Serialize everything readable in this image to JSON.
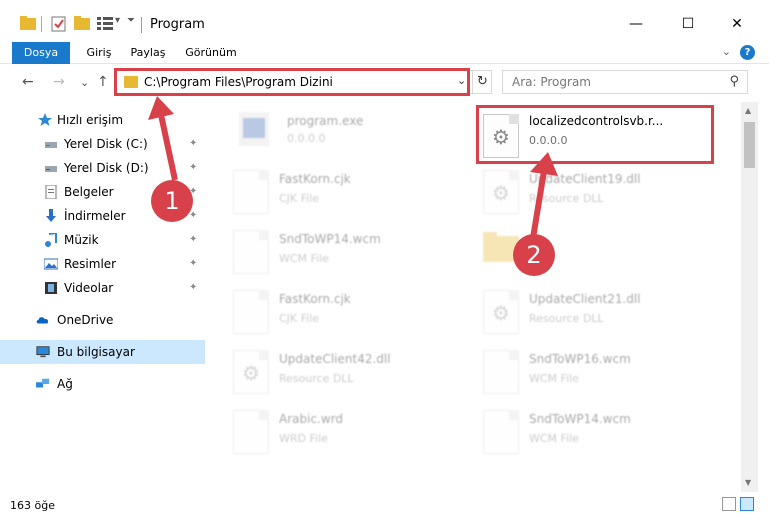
{
  "window": {
    "title": "Program",
    "minimize": "—",
    "maximize": "☐",
    "close": "✕"
  },
  "ribbon": {
    "tabs": [
      "Dosya",
      "Giriş",
      "Paylaş",
      "Görünüm"
    ],
    "collapse": "⌄",
    "help": "?"
  },
  "nav": {
    "back": "←",
    "forward": "→",
    "recent": "⌄",
    "up": "↑",
    "address": "C:\\Program Files\\Program Dizini",
    "address_drop": "⌄",
    "refresh": "↻",
    "search_placeholder": "Ara: Program",
    "search_glyph": "⚲"
  },
  "sidebar": {
    "items": [
      {
        "label": "Hızlı erişim",
        "icon": "star-icon",
        "pinned": false
      },
      {
        "label": "Yerel Disk (C:)",
        "icon": "drive-icon",
        "pinned": true
      },
      {
        "label": "Yerel Disk (D:)",
        "icon": "drive-icon",
        "pinned": true
      },
      {
        "label": "Belgeler",
        "icon": "document-icon",
        "pinned": true
      },
      {
        "label": "İndirmeler",
        "icon": "download-icon",
        "pinned": true
      },
      {
        "label": "Müzik",
        "icon": "music-icon",
        "pinned": true
      },
      {
        "label": "Resimler",
        "icon": "image-icon",
        "pinned": true
      },
      {
        "label": "Videolar",
        "icon": "video-icon",
        "pinned": true
      },
      {
        "label": "OneDrive",
        "icon": "cloud-icon",
        "pinned": false
      },
      {
        "label": "Bu bilgisayar",
        "icon": "computer-icon",
        "pinned": false,
        "selected": true
      },
      {
        "label": "Ağ",
        "icon": "network-icon",
        "pinned": false
      }
    ],
    "pin_glyph": "📌"
  },
  "files": [
    {
      "name": "program.exe",
      "type": "0.0.0.0",
      "icon": "exe-icon"
    },
    {
      "name": "localizedcontrolsvb.r...",
      "type": "0.0.0.0",
      "icon": "gear-file-icon"
    },
    {
      "name": "FastKorn.cjk",
      "type": "CJK File",
      "icon": "blank-file-icon"
    },
    {
      "name": "UpdateClient19.dll",
      "type": "Resource DLL",
      "icon": "gear-file-icon"
    },
    {
      "name": "SndToWP14.wcm",
      "type": "WCM File",
      "icon": "blank-file-icon"
    },
    {
      "name": "",
      "type": "",
      "icon": "folder-icon"
    },
    {
      "name": "FastKorn.cjk",
      "type": "CJK File",
      "icon": "blank-file-icon"
    },
    {
      "name": "UpdateClient21.dll",
      "type": "Resource DLL",
      "icon": "gear-file-icon"
    },
    {
      "name": "UpdateClient42.dll",
      "type": "Resource DLL",
      "icon": "gear-file-icon"
    },
    {
      "name": "SndToWP16.wcm",
      "type": "WCM File",
      "icon": "blank-file-icon"
    },
    {
      "name": "Arabic.wrd",
      "type": "WRD File",
      "icon": "blank-file-icon"
    },
    {
      "name": "SndToWP14.wcm",
      "type": "WCM File",
      "icon": "blank-file-icon"
    }
  ],
  "status": {
    "count": "163 öğe"
  },
  "callouts": [
    "1",
    "2"
  ],
  "colors": {
    "accent": "#1979ca",
    "highlight": "#d9414a",
    "selected": "#cce8ff"
  }
}
